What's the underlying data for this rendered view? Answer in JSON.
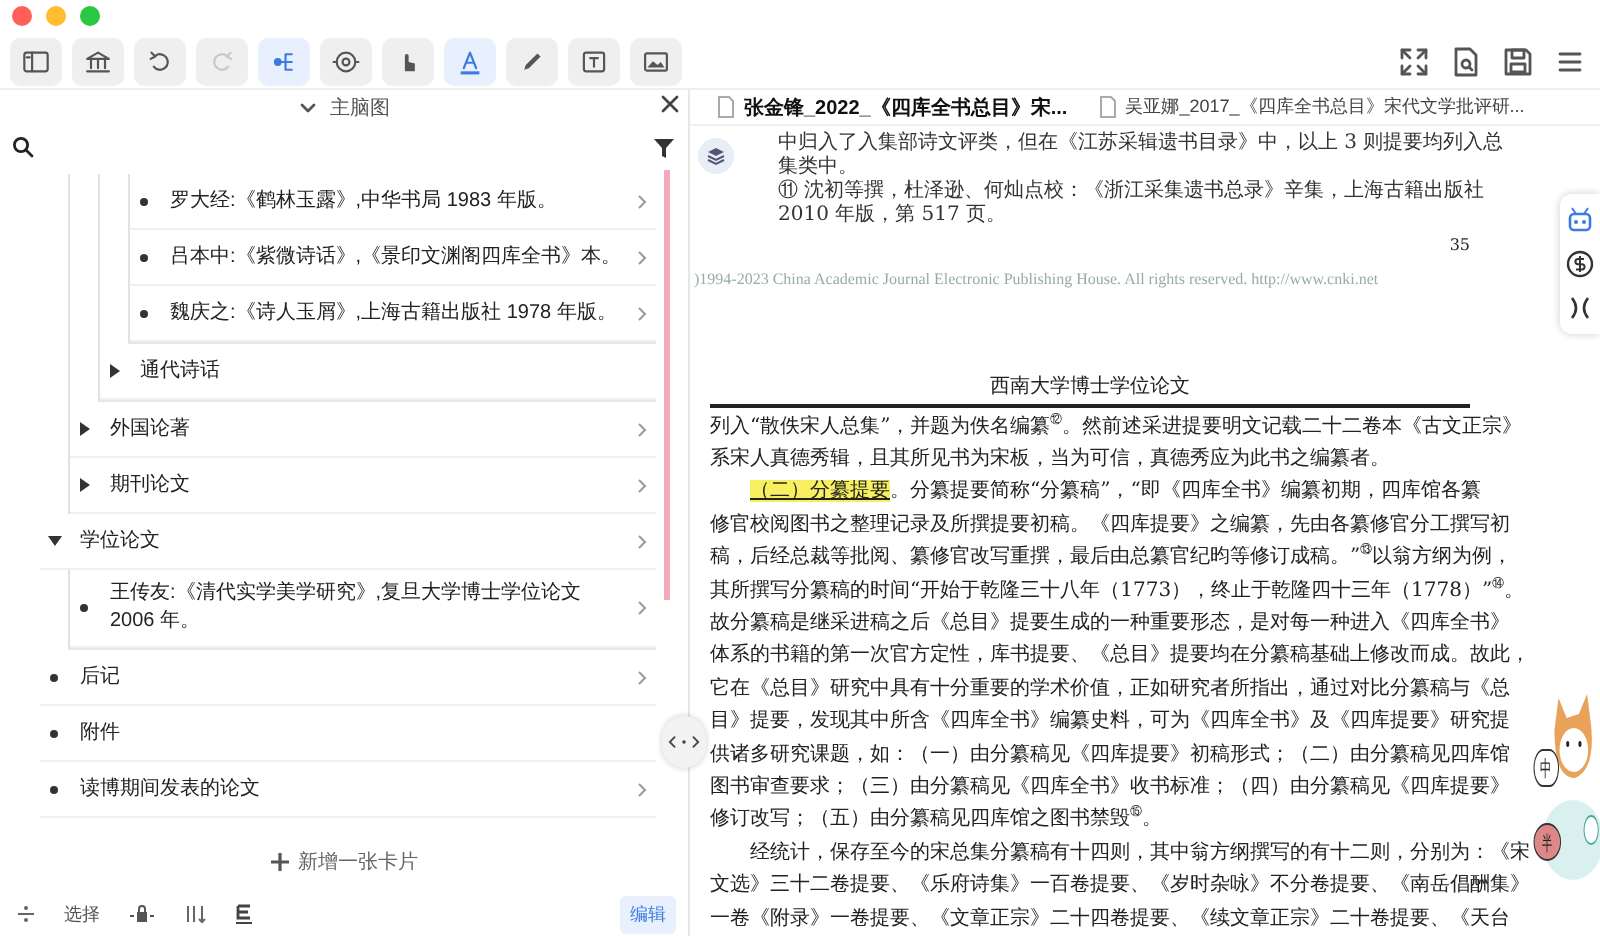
{
  "toolbar": {
    "tools": [
      {
        "selected": false,
        "disabled": false
      },
      {
        "selected": false,
        "disabled": false
      },
      {
        "selected": false,
        "disabled": false
      },
      {
        "selected": false,
        "disabled": true
      },
      {
        "selected": true,
        "disabled": false
      },
      {
        "selected": false,
        "disabled": false
      },
      {
        "selected": false,
        "disabled": false
      },
      {
        "selected": true,
        "disabled": false
      },
      {
        "selected": false,
        "disabled": false
      },
      {
        "selected": false,
        "disabled": false
      },
      {
        "selected": false,
        "disabled": false
      }
    ]
  },
  "outline_panel": {
    "title": "主脑图",
    "tree": [
      {
        "kind": "continued",
        "children": [
          {
            "kind": "continued",
            "children": [
              {
                "kind": "continued",
                "children": [
                  {
                    "kind": "leaf",
                    "label": "罗大经:《鹤林玉露》,中华书局 1983 年版。",
                    "has_detail": true
                  },
                  {
                    "kind": "leaf",
                    "label": "吕本中:《紫微诗话》,《景印文渊阁四库全书》本。",
                    "has_detail": true
                  },
                  {
                    "kind": "leaf",
                    "label": "魏庆之:《诗人玉屑》,上海古籍出版社 1978 年版。",
                    "has_detail": true
                  }
                ]
              },
              {
                "kind": "group",
                "label": "通代诗话",
                "expanded": false,
                "has_detail": false
              }
            ]
          },
          {
            "kind": "group",
            "label": "外国论著",
            "expanded": false,
            "has_detail": true
          },
          {
            "kind": "group",
            "label": "期刊论文",
            "expanded": false,
            "has_detail": true
          }
        ]
      },
      {
        "kind": "group",
        "label": "学位论文",
        "expanded": true,
        "has_detail": true,
        "children": [
          {
            "kind": "leaf",
            "label": "王传友:《清代实学美学研究》,复旦大学博士学位论文 2006 年。",
            "has_detail": true
          }
        ]
      },
      {
        "kind": "leaf",
        "label": "后记",
        "has_detail": true
      },
      {
        "kind": "leaf",
        "label": "附件",
        "has_detail": false
      },
      {
        "kind": "leaf",
        "label": "读博期间发表的论文",
        "has_detail": true
      }
    ],
    "add_card": "新增一张卡片",
    "select_label": "选择",
    "edit_label": "编辑"
  },
  "document": {
    "tabs": [
      {
        "label": "张金锋_2022_《四库全书总目》宋...",
        "selected": true
      },
      {
        "label": "吴亚娜_2017_《四库全书总目》宋代文学批评研...",
        "selected": false
      }
    ],
    "footnotes": [
      "中归入了入集部诗文评类，但在《江苏采辑遗书目录》中，以上 3 则提要均列入总集类中。",
      "⑪ 沈初等撰，杜泽逊、何灿点校：《浙江采集遗书总录》辛集，上海古籍出版社 2010 年版，第 517 页。"
    ],
    "page_number": "35",
    "copyright": ")1994-2023 China Academic Journal Electronic Publishing House. All rights reserved.    http://www.cnki.net",
    "running_header": "西南大学博士学位论文",
    "lines": [
      {
        "text": "列入“散佚宋人总集”，并题为佚名编纂$^{⑫}$。然前述采进提要明文记载二十二卷本《古文正宗》",
        "indent": false
      },
      {
        "text": "系宋人真德秀辑，且其所见书为宋板，当为可信，真德秀应为此书之编纂者。",
        "indent": false
      },
      {
        "highlight": "（二）分纂提要",
        "text": "。分纂提要简称“分纂稿”，“即《四库全书》编纂初期，四库馆各纂",
        "indent": true
      },
      {
        "text": "修官校阅图书之整理记录及所撰提要初稿。《四库提要》之编纂，先由各纂修官分工撰写初",
        "indent": false
      },
      {
        "text": "稿，后经总裁等批阅、纂修官改写重撰，最后由总纂官纪昀等修订成稿。”$^{⑬}$以翁方纲为例，",
        "indent": false
      },
      {
        "text": "其所撰写分纂稿的时间“开始于乾隆三十八年（1773），终止于乾隆四十三年（1778）”$^{⑭}$。",
        "indent": false
      },
      {
        "text": "故分纂稿是继采进稿之后《总目》提要生成的一种重要形态，是对每一种进入《四库全书》",
        "indent": false
      },
      {
        "text": "体系的书籍的第一次官方定性，库书提要、《总目》提要均在分纂稿基础上修改而成。故此，",
        "indent": false
      },
      {
        "text": "它在《总目》研究中具有十分重要的学术价值，正如研究者所指出，通过对比分纂稿与《总",
        "indent": false
      },
      {
        "text": "目》提要，发现其中所含《四库全书》编纂史料，可为《四库全书》及《四库提要》研究提",
        "indent": false
      },
      {
        "text": "供诸多研究课题，如：（一）由分纂稿见《四库提要》初稿形式；（二）由分纂稿见四库馆",
        "indent": false
      },
      {
        "text": "图书审查要求；（三）由分纂稿见《四库全书》收书标准；（四）由分纂稿见《四库提要》",
        "indent": false
      },
      {
        "text": "修订改写；（五）由分纂稿见四库馆之图书禁毁$^{⑮}$。",
        "indent": false
      },
      {
        "text": "经统计，保存至今的宋总集分纂稿有十四则，其中翁方纲撰写的有十二则，分别为：《宋",
        "indent": true
      },
      {
        "text": "文选》三十二卷提要、《乐府诗集》一百卷提要、《岁时杂咏》不分卷提要、《南岳倡酬集》",
        "indent": false
      },
      {
        "text": "一卷《附录》一卷提要、《文章正宗》二十四卷提要、《续文章正宗》二十卷提要、《天台",
        "indent": false
      }
    ]
  },
  "mascot": {
    "badges": [
      "中",
      "半"
    ]
  }
}
